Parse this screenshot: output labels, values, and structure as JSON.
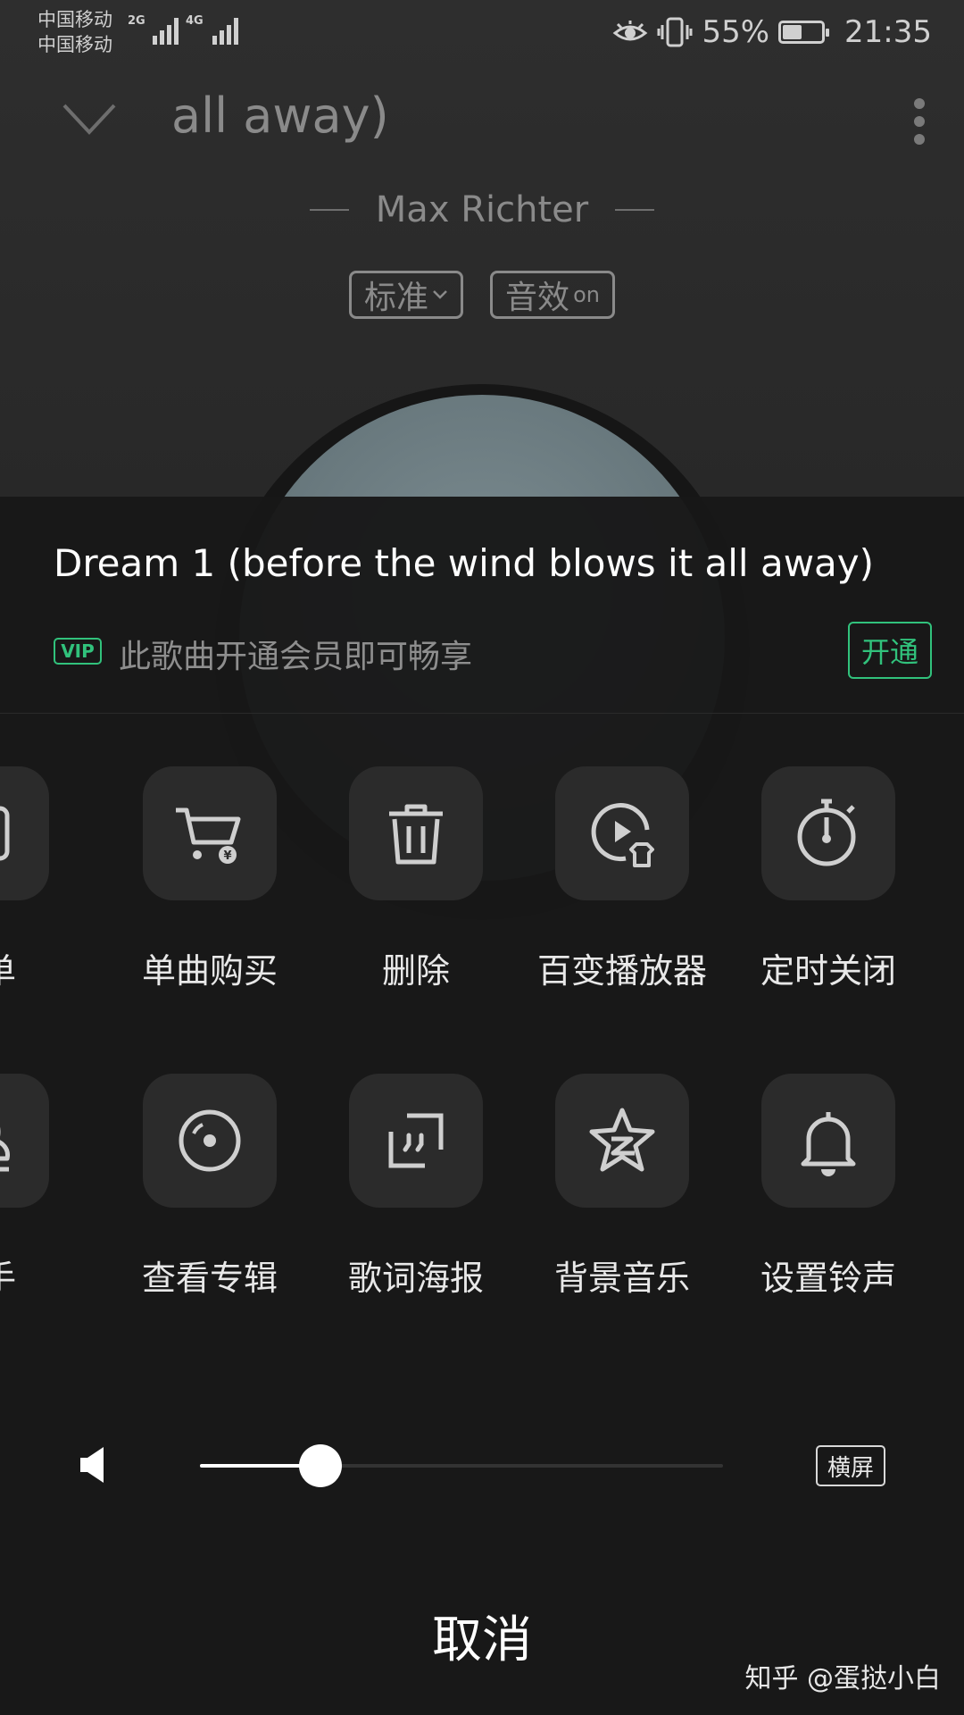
{
  "status_bar": {
    "carrier_1": "中国移动",
    "carrier_2": "中国移动",
    "net_1": "2G",
    "net_2": "4G",
    "battery": "55%",
    "battery_level": 0.55,
    "time": "21:35"
  },
  "player": {
    "title_visible": "all away)",
    "artist": "Max Richter",
    "quality_chip": "标准",
    "effect_chip": "音效",
    "effect_state": "on"
  },
  "sheet": {
    "song_title": "Dream 1 (before the wind blows it all away)",
    "vip_badge": "VIP",
    "vip_text": "此歌曲开通会员即可畅享",
    "open_button": "开通",
    "row1": [
      {
        "label": "歌单",
        "icon": "add-to-playlist-icon"
      },
      {
        "label": "单曲购买",
        "icon": "shopping-cart-icon"
      },
      {
        "label": "删除",
        "icon": "trash-icon"
      },
      {
        "label": "百变播放器",
        "icon": "player-skin-icon"
      },
      {
        "label": "定时关闭",
        "icon": "timer-icon"
      }
    ],
    "row2": [
      {
        "label": "歌手",
        "icon": "singer-icon"
      },
      {
        "label": "查看专辑",
        "icon": "album-icon"
      },
      {
        "label": "歌词海报",
        "icon": "lyrics-poster-icon"
      },
      {
        "label": "背景音乐",
        "icon": "qzone-star-icon"
      },
      {
        "label": "设置铃声",
        "icon": "bell-icon"
      }
    ],
    "volume_level": 0.23,
    "landscape_button": "横屏",
    "cancel": "取消"
  },
  "watermark": "知乎 @蛋挞小白",
  "colors": {
    "accent_green": "#31c27c",
    "tile_bg": "#2b2b2b",
    "sheet_bg": "#181818"
  }
}
